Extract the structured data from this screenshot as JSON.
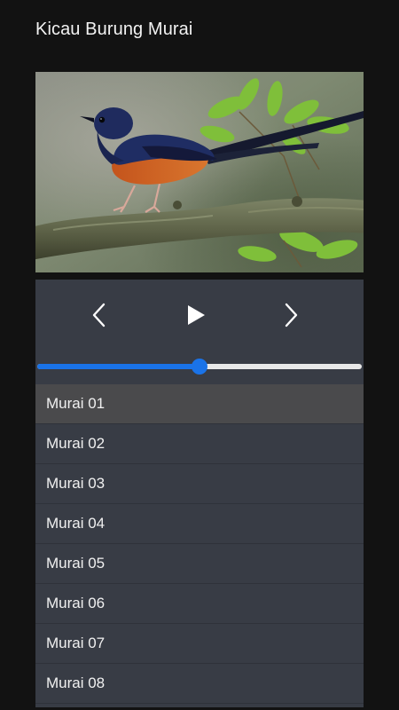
{
  "app": {
    "title": "Kicau Burung Murai"
  },
  "artwork": {
    "subject": "white-rumped shama bird perched on a branch"
  },
  "controls": {
    "prev_icon": "chevron-left-icon",
    "play_icon": "play-icon",
    "next_icon": "chevron-right-icon"
  },
  "seek": {
    "progress": 0.5,
    "played_color": "#1a73e8",
    "remaining_color": "#e8e8e8"
  },
  "playlist": {
    "active_index": 0,
    "items": [
      {
        "label": "Murai 01"
      },
      {
        "label": "Murai 02"
      },
      {
        "label": "Murai 03"
      },
      {
        "label": "Murai 04"
      },
      {
        "label": "Murai 05"
      },
      {
        "label": "Murai 06"
      },
      {
        "label": "Murai 07"
      },
      {
        "label": "Murai 08"
      }
    ]
  },
  "colors": {
    "background": "#121212",
    "panel": "#383c45",
    "active_row": "#4a4a4c",
    "accent": "#1a73e8"
  }
}
